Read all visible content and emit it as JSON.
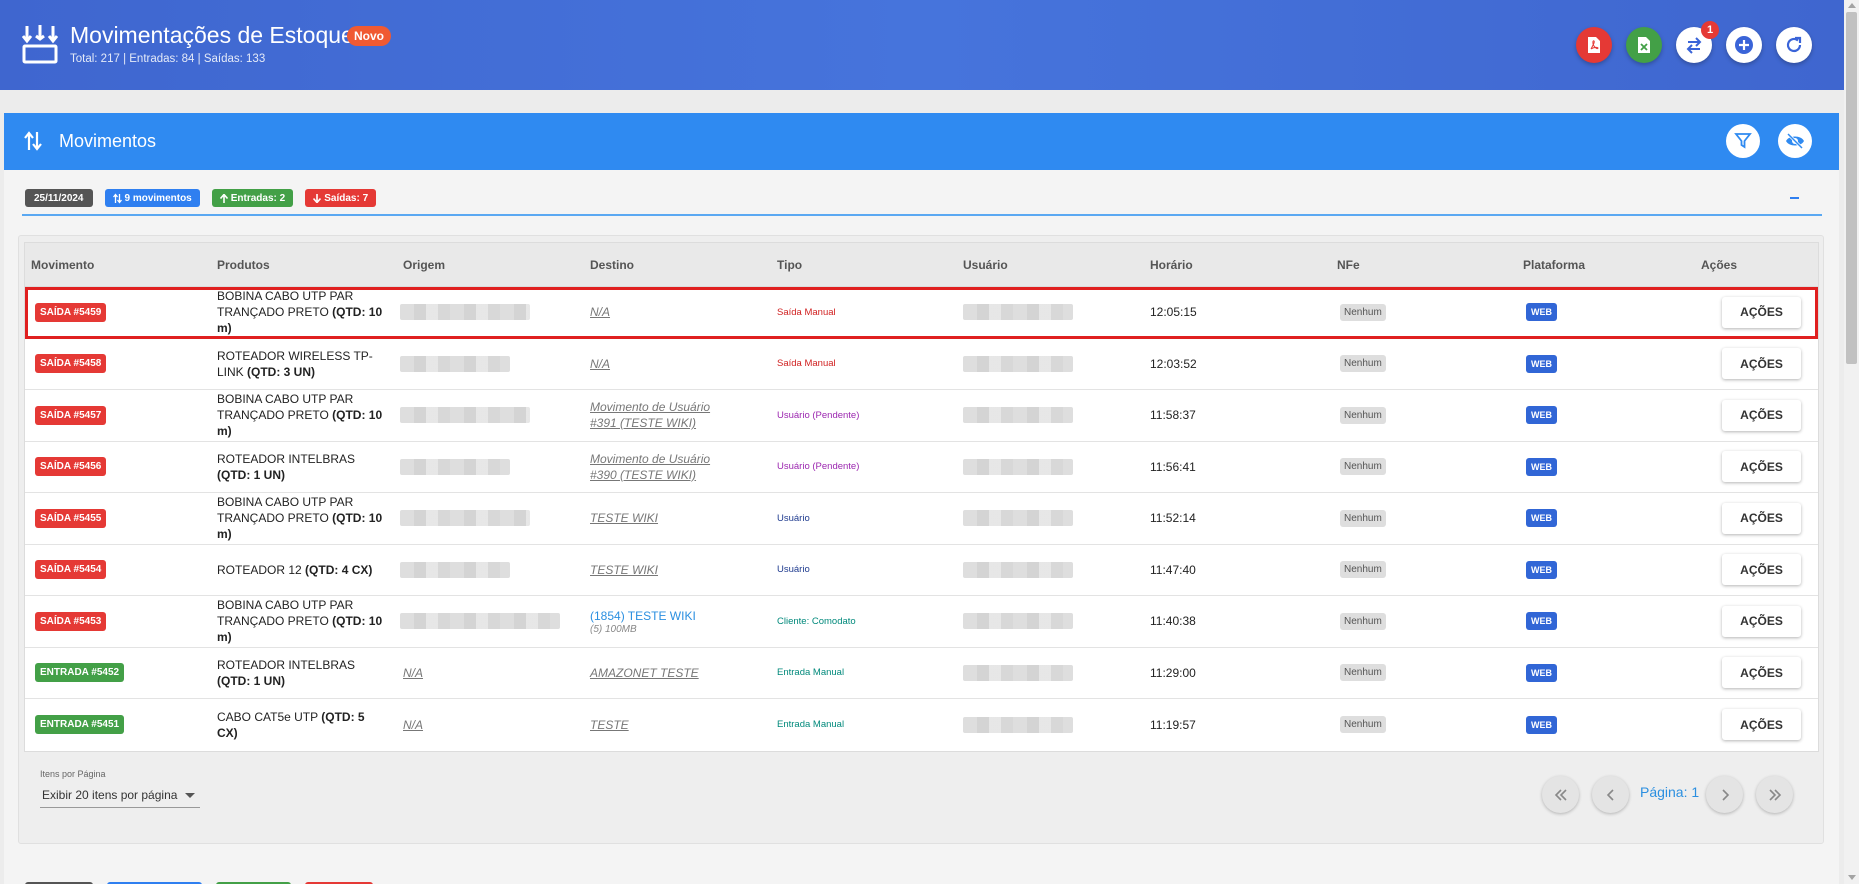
{
  "header": {
    "title": "Movimentações de Estoque",
    "badge": "Novo",
    "subtitle": "Total: 217 | Entradas: 84 | Saídas: 133",
    "notif_count": "1",
    "buttons": [
      "pdf-export",
      "excel-export",
      "transfer",
      "add",
      "refresh"
    ]
  },
  "card": {
    "title": "Movimentos",
    "chips": {
      "date": "25/11/2024",
      "movimentos": "9 movimentos",
      "entradas": "Entradas: 2",
      "saidas": "Saídas: 7"
    }
  },
  "table": {
    "columns": [
      "Movimento",
      "Produtos",
      "Origem",
      "Destino",
      "Tipo",
      "Usuário",
      "Horário",
      "NFe",
      "Plataforma",
      "Ações"
    ],
    "rows": [
      {
        "mov": "SAÍDA #5459",
        "kind": "saida",
        "prod_name": "BOBINA CABO UTP PAR TRANÇADO PRETO ",
        "prod_qtd": "(QTD: 10 m)",
        "destino": "N/A",
        "destino_sub": "",
        "dest_style": "link",
        "tipo": "Saída Manual",
        "tipo_color": "red",
        "hora": "12:05:15",
        "nfe": "Nenhum",
        "plat": "WEB",
        "acao": "AÇÕES",
        "selected": true
      },
      {
        "mov": "SAÍDA #5458",
        "kind": "saida",
        "prod_name": "ROTEADOR WIRELESS TP-LINK ",
        "prod_qtd": "(QTD: 3 UN)",
        "destino": "N/A",
        "destino_sub": "",
        "dest_style": "link",
        "tipo": "Saída Manual",
        "tipo_color": "red",
        "hora": "12:03:52",
        "nfe": "Nenhum",
        "plat": "WEB",
        "acao": "AÇÕES"
      },
      {
        "mov": "SAÍDA #5457",
        "kind": "saida",
        "prod_name": "BOBINA CABO UTP PAR TRANÇADO PRETO ",
        "prod_qtd": "(QTD: 10 m)",
        "destino": "Movimento de Usuário #391 (TESTE WIKI)",
        "destino_sub": "",
        "dest_style": "link",
        "tipo": "Usuário (Pendente)",
        "tipo_color": "purple",
        "hora": "11:58:37",
        "nfe": "Nenhum",
        "plat": "WEB",
        "acao": "AÇÕES"
      },
      {
        "mov": "SAÍDA #5456",
        "kind": "saida",
        "prod_name": "ROTEADOR INTELBRAS ",
        "prod_qtd": "(QTD: 1 UN)",
        "destino": "Movimento de Usuário #390 (TESTE WIKI)",
        "destino_sub": "",
        "dest_style": "link",
        "tipo": "Usuário (Pendente)",
        "tipo_color": "purple",
        "hora": "11:56:41",
        "nfe": "Nenhum",
        "plat": "WEB",
        "acao": "AÇÕES"
      },
      {
        "mov": "SAÍDA #5455",
        "kind": "saida",
        "prod_name": "BOBINA CABO UTP PAR TRANÇADO PRETO ",
        "prod_qtd": "(QTD: 10 m)",
        "destino": "TESTE WIKI",
        "destino_sub": "",
        "dest_style": "link",
        "tipo": "Usuário",
        "tipo_color": "navy",
        "hora": "11:52:14",
        "nfe": "Nenhum",
        "plat": "WEB",
        "acao": "AÇÕES"
      },
      {
        "mov": "SAÍDA #5454",
        "kind": "saida",
        "prod_name": "ROTEADOR 12 ",
        "prod_qtd": "(QTD: 4 CX)",
        "destino": "TESTE WIKI",
        "destino_sub": "",
        "dest_style": "link",
        "tipo": "Usuário",
        "tipo_color": "navy",
        "hora": "11:47:40",
        "nfe": "Nenhum",
        "plat": "WEB",
        "acao": "AÇÕES"
      },
      {
        "mov": "SAÍDA #5453",
        "kind": "saida",
        "prod_name": "BOBINA CABO UTP PAR TRANÇADO PRETO ",
        "prod_qtd": "(QTD: 10 m)",
        "destino": "(1854) TESTE WIKI",
        "destino_sub": "(5) 100MB",
        "dest_style": "blue",
        "tipo": "Cliente: Comodato",
        "tipo_color": "teal",
        "hora": "11:40:38",
        "nfe": "Nenhum",
        "plat": "WEB",
        "acao": "AÇÕES"
      },
      {
        "mov": "ENTRADA #5452",
        "kind": "entrada",
        "prod_name": "ROTEADOR INTELBRAS ",
        "prod_qtd": "(QTD: 1 UN)",
        "origem": "N/A",
        "destino": "AMAZONET TESTE",
        "destino_sub": "",
        "dest_style": "link",
        "tipo": "Entrada Manual",
        "tipo_color": "teal",
        "hora": "11:29:00",
        "nfe": "Nenhum",
        "plat": "WEB",
        "acao": "AÇÕES"
      },
      {
        "mov": "ENTRADA #5451",
        "kind": "entrada",
        "prod_name": "CABO CAT5e UTP ",
        "prod_qtd": "(QTD: 5 CX)",
        "origem": "N/A",
        "destino": "TESTE",
        "destino_sub": "",
        "dest_style": "link",
        "tipo": "Entrada Manual",
        "tipo_color": "teal",
        "hora": "11:19:57",
        "nfe": "Nenhum",
        "plat": "WEB",
        "acao": "AÇÕES"
      }
    ]
  },
  "pagination": {
    "items_label": "Itens por Página",
    "items_value": "Exibir 20 itens por página",
    "page_label": "Página: 1"
  },
  "colors": {
    "header": "#4674dc",
    "card_head": "#2f8af1",
    "saida": "#e53935",
    "entrada": "#43a047",
    "selection": "#e02020"
  }
}
